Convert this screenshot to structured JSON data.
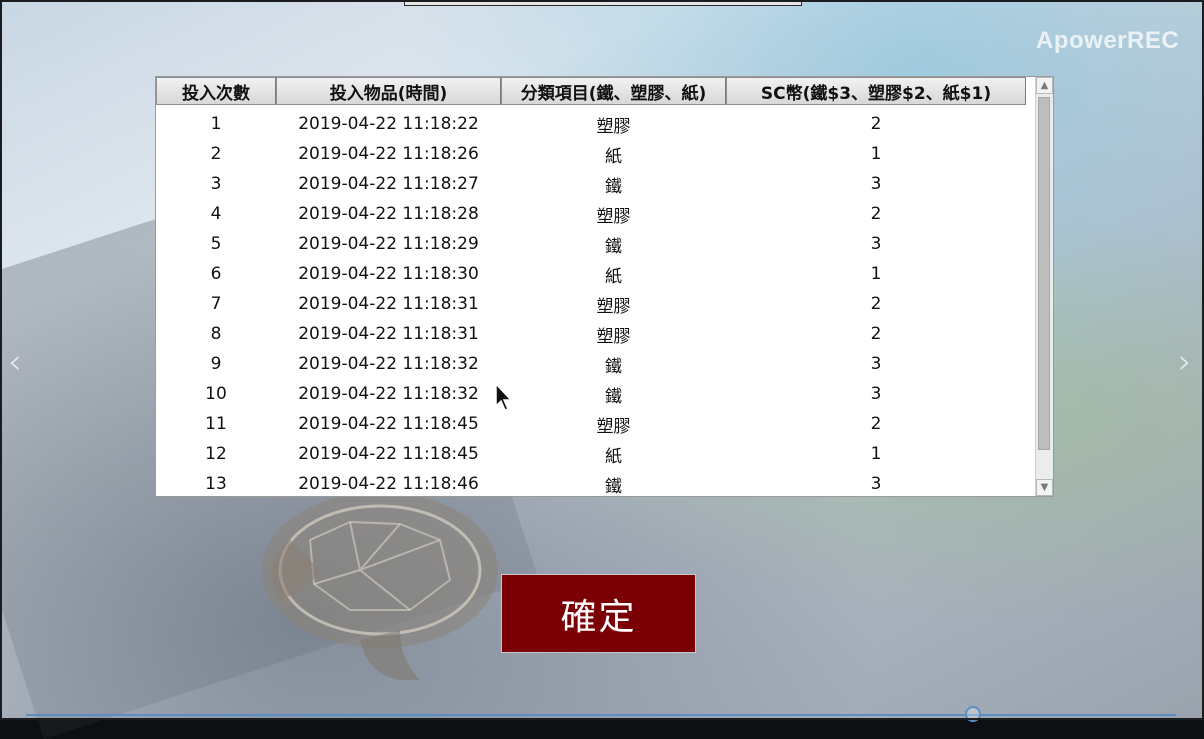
{
  "overlay": {
    "watermark": "ApowerREC"
  },
  "navigation": {
    "prev_icon": "chevron-left-icon",
    "next_icon": "chevron-right-icon"
  },
  "table": {
    "columns": [
      "投入次數",
      "投入物品(時間)",
      "分類項目(鐵、塑膠、紙)",
      "SC幣(鐵$3、塑膠$2、紙$1)"
    ],
    "rows": [
      [
        "1",
        "2019-04-22 11:18:22",
        "塑膠",
        "2"
      ],
      [
        "2",
        "2019-04-22 11:18:26",
        "紙",
        "1"
      ],
      [
        "3",
        "2019-04-22 11:18:27",
        "鐵",
        "3"
      ],
      [
        "4",
        "2019-04-22 11:18:28",
        "塑膠",
        "2"
      ],
      [
        "5",
        "2019-04-22 11:18:29",
        "鐵",
        "3"
      ],
      [
        "6",
        "2019-04-22 11:18:30",
        "紙",
        "1"
      ],
      [
        "7",
        "2019-04-22 11:18:31",
        "塑膠",
        "2"
      ],
      [
        "8",
        "2019-04-22 11:18:31",
        "塑膠",
        "2"
      ],
      [
        "9",
        "2019-04-22 11:18:32",
        "鐵",
        "3"
      ],
      [
        "10",
        "2019-04-22 11:18:32",
        "鐵",
        "3"
      ],
      [
        "11",
        "2019-04-22 11:18:45",
        "塑膠",
        "2"
      ],
      [
        "12",
        "2019-04-22 11:18:45",
        "紙",
        "1"
      ],
      [
        "13",
        "2019-04-22 11:18:46",
        "鐵",
        "3"
      ]
    ]
  },
  "buttons": {
    "confirm_label": "確定"
  },
  "colors": {
    "confirm_bg": "#7a0006",
    "accent": "#5a8fc4"
  }
}
